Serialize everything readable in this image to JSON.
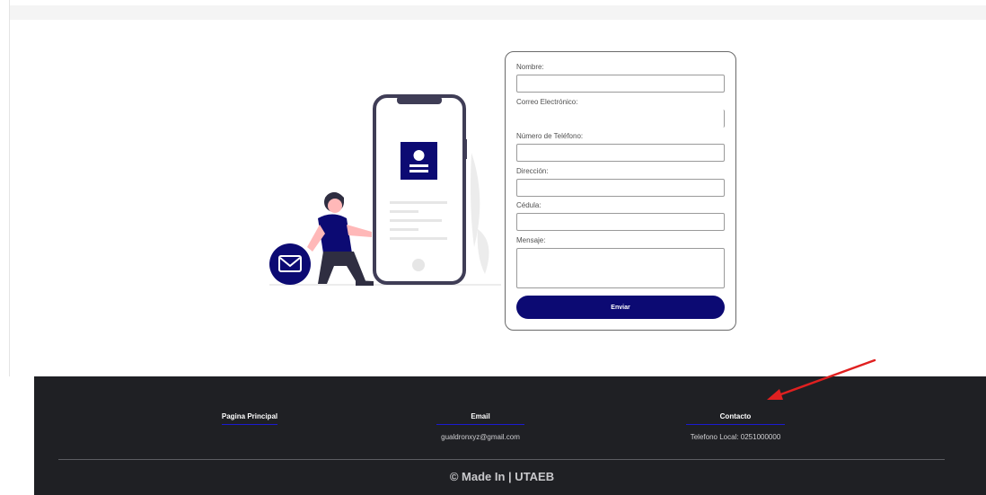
{
  "form": {
    "fields": [
      {
        "label": "Nombre:"
      },
      {
        "label": "Correo Electrónico:"
      },
      {
        "label": "Número de Teléfono:"
      },
      {
        "label": "Dirección:"
      },
      {
        "label": "Cédula:"
      },
      {
        "label": "Mensaje:"
      }
    ],
    "submit_label": "Enviar"
  },
  "footer": {
    "columns": [
      {
        "title": "Pagina Principal",
        "text": ""
      },
      {
        "title": "Email",
        "text": "gualdronxyz@gmail.com"
      },
      {
        "title": "Contacto",
        "text": "Telefono Local: 0251000000"
      }
    ],
    "copyright": "© Made In | UTAEB"
  },
  "colors": {
    "primary": "#0c0a73",
    "footer_bg": "#1f2024",
    "annotation": "#e02020"
  }
}
